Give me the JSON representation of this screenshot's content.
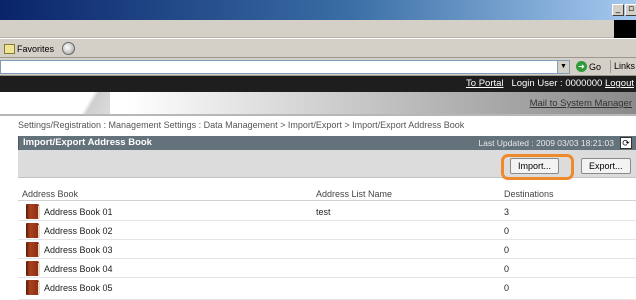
{
  "window": {
    "min_glyph": "_",
    "restore_glyph": "▫"
  },
  "toolbar": {
    "favorites_label": "Favorites"
  },
  "address_bar": {
    "dropdown_glyph": "▼",
    "go_label": "Go",
    "go_glyph": "➜",
    "links_label": "Links"
  },
  "header": {
    "to_portal": "To Portal",
    "login_user": "Login User : 0000000",
    "logout": "Logout",
    "mail_link": "Mail to System Manager"
  },
  "breadcrumb": "Settings/Registration : Management Settings : Data Management > Import/Export > Import/Export Address Book",
  "section": {
    "title": "Import/Export Address Book",
    "last_updated": "Last Updated : 2009 03/03 18:21:03",
    "refresh_glyph": "⟳"
  },
  "buttons": {
    "import": "Import...",
    "export": "Export..."
  },
  "table": {
    "columns": [
      "Address Book",
      "Address List Name",
      "Destinations"
    ],
    "rows": [
      {
        "book": "Address Book 01",
        "list_name": "test",
        "destinations": "3"
      },
      {
        "book": "Address Book 02",
        "list_name": "",
        "destinations": "0"
      },
      {
        "book": "Address Book 03",
        "list_name": "",
        "destinations": "0"
      },
      {
        "book": "Address Book 04",
        "list_name": "",
        "destinations": "0"
      },
      {
        "book": "Address Book 05",
        "list_name": "",
        "destinations": "0"
      }
    ]
  },
  "colors": {
    "highlight": "#ee8a2c",
    "section_bar": "#64727c",
    "header_dark": "#1e1e1e"
  }
}
